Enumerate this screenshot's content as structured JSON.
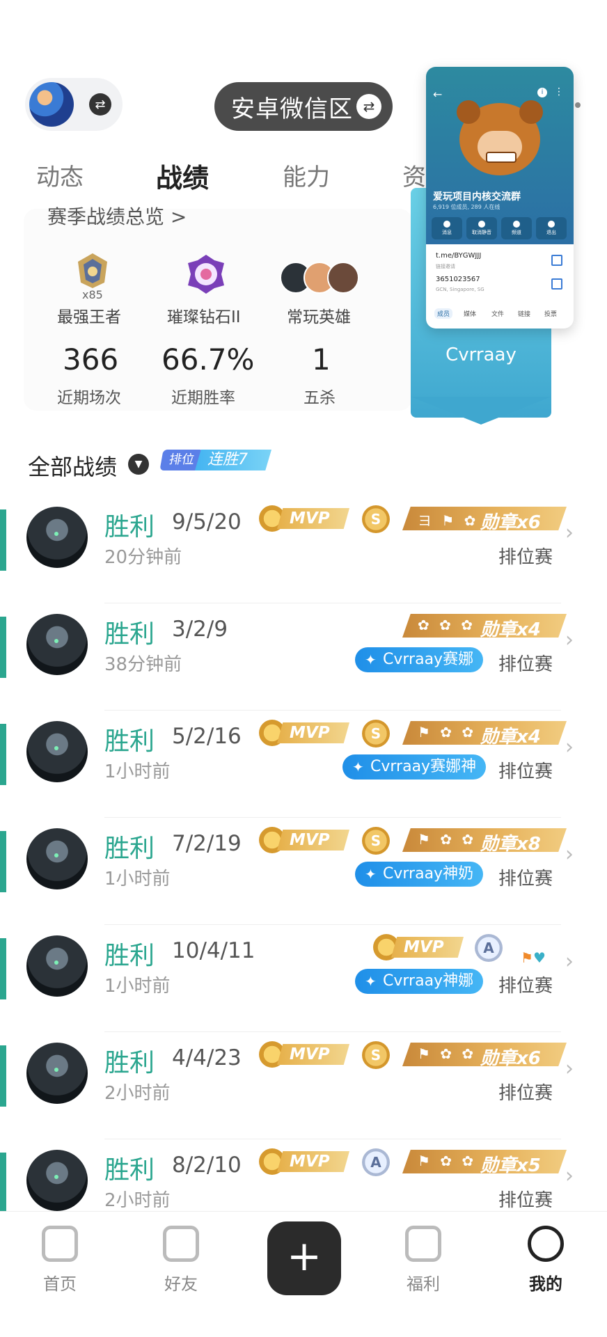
{
  "header": {
    "swap_icon": "swap-icon",
    "region": "安卓微信区"
  },
  "tabs": [
    {
      "label": "动态",
      "active": false
    },
    {
      "label": "战绩",
      "active": true
    },
    {
      "label": "能力",
      "active": false
    },
    {
      "label": "资",
      "active": false
    }
  ],
  "season": {
    "link": "赛季战绩总览 >",
    "ranks": [
      {
        "name": "最强王者",
        "stars": "x85"
      },
      {
        "name": "璀璨钻石II"
      },
      {
        "name": "常玩英雄"
      }
    ],
    "stats": [
      {
        "value": "366",
        "label": "近期场次"
      },
      {
        "value": "66.7%",
        "label": "近期胜率"
      },
      {
        "value": "1",
        "label": "五杀"
      }
    ]
  },
  "ribbon": {
    "name": "Cvrraay"
  },
  "popup": {
    "title": "爱玩项目内核交流群",
    "subtitle": "6,919 位成员, 289 人在线",
    "actions": [
      "消息",
      "取消静音",
      "频道",
      "退出"
    ],
    "links": [
      {
        "text": "t.me/BYGWJJJ",
        "sub": "链接邀请"
      },
      {
        "text": "3651023567",
        "sub": "GCN, Singapore, SG"
      }
    ],
    "tabs": [
      "成员",
      "媒体",
      "文件",
      "链接",
      "投票"
    ]
  },
  "all_records": {
    "title": "全部战绩",
    "streak_tag": "排位",
    "streak_text": "连胜7"
  },
  "matches": [
    {
      "result": "胜利",
      "kda": "9/5/20",
      "time": "20分钟前",
      "mode": "排位赛",
      "mvp": true,
      "grade": "S",
      "medal_icons": "ヨ ⚑ ✿",
      "medal": "勋章x6",
      "title": ""
    },
    {
      "result": "胜利",
      "kda": "3/2/9",
      "time": "38分钟前",
      "mode": "排位赛",
      "mvp": false,
      "grade": "",
      "medal_icons": "✿ ✿ ✿",
      "medal": "勋章x4",
      "title": "Cvrraay赛娜"
    },
    {
      "result": "胜利",
      "kda": "5/2/16",
      "time": "1小时前",
      "mode": "排位赛",
      "mvp": true,
      "grade": "S",
      "medal_icons": "⚑ ✿ ✿",
      "medal": "勋章x4",
      "title": "Cvrraay赛娜神"
    },
    {
      "result": "胜利",
      "kda": "7/2/19",
      "time": "1小时前",
      "mode": "排位赛",
      "mvp": true,
      "grade": "S",
      "medal_icons": "⚑ ✿ ✿",
      "medal": "勋章x8",
      "title": "Cvrraay神奶"
    },
    {
      "result": "胜利",
      "kda": "10/4/11",
      "time": "1小时前",
      "mode": "排位赛",
      "mvp": true,
      "grade": "A",
      "medal_icons": "",
      "medal": "",
      "title": "Cvrraay神娜"
    },
    {
      "result": "胜利",
      "kda": "4/4/23",
      "time": "2小时前",
      "mode": "排位赛",
      "mvp": true,
      "grade": "S",
      "medal_icons": "⚑ ✿ ✿",
      "medal": "勋章x6",
      "title": ""
    },
    {
      "result": "胜利",
      "kda": "8/2/10",
      "time": "2小时前",
      "mode": "排位赛",
      "mvp": true,
      "grade": "A",
      "medal_icons": "⚑ ✿ ✿",
      "medal": "勋章x5",
      "title": ""
    }
  ],
  "bottom_nav": [
    {
      "label": "首页",
      "icon": "home-icon"
    },
    {
      "label": "好友",
      "icon": "chat-icon"
    },
    {
      "label": "福利",
      "icon": "gift-icon"
    },
    {
      "label": "我的",
      "icon": "user-icon",
      "active": true
    }
  ],
  "colors": {
    "win": "#2ba68f",
    "accent_blue": "#1f8fe8",
    "gold": "#e6b04a"
  }
}
